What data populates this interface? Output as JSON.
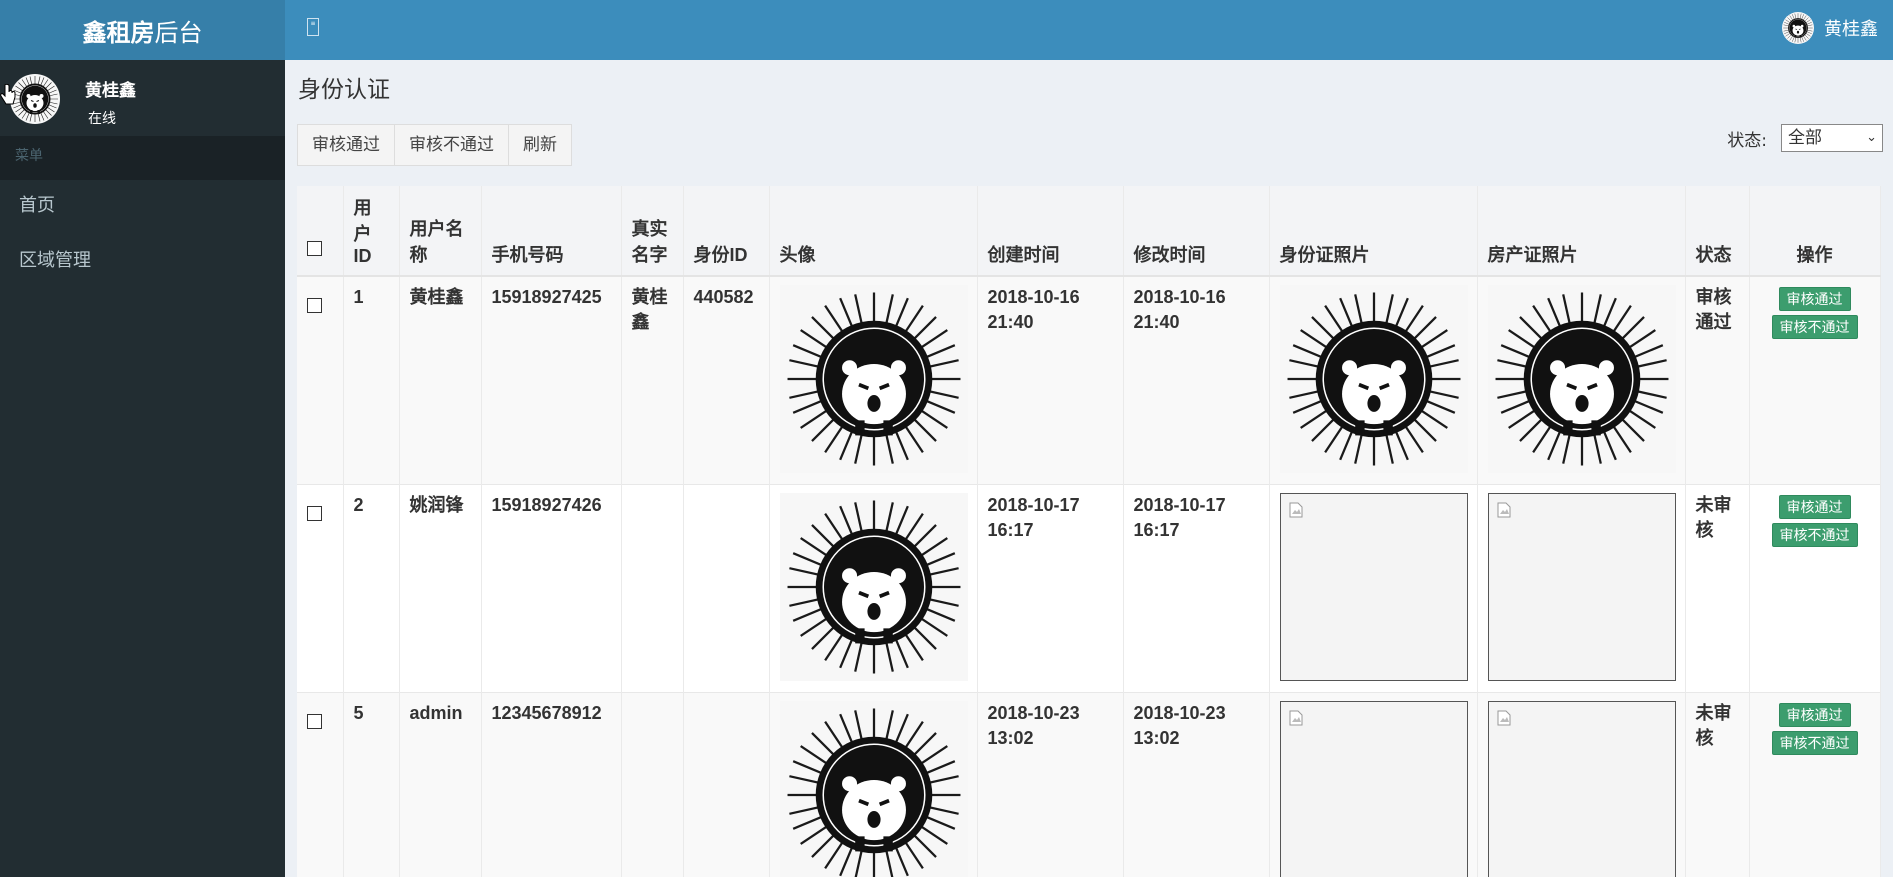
{
  "header": {
    "brand_bold": "鑫租房",
    "brand_light": "后台",
    "toggle_glyph": "≡",
    "user_name": "黄桂鑫"
  },
  "sidebar": {
    "user_name": "黄桂鑫",
    "user_status": "在线",
    "menu_header": "菜单",
    "items": [
      {
        "label": "首页"
      },
      {
        "label": "区域管理"
      }
    ]
  },
  "main": {
    "title": "身份认证",
    "actions": {
      "approve": "审核通过",
      "reject": "审核不通过",
      "refresh": "刷新"
    },
    "filter": {
      "label": "状态:",
      "selected": "全部"
    },
    "table": {
      "headers": {
        "id": "用户ID",
        "username": "用户名称",
        "phone": "手机号码",
        "realname": "真实名字",
        "idnum": "身份ID",
        "avatar": "头像",
        "created": "创建时间",
        "modified": "修改时间",
        "idphoto": "身份证照片",
        "deedphoto": "房产证照片",
        "status": "状态",
        "ops": "操作"
      },
      "rows": [
        {
          "id": "1",
          "username": "黄桂鑫",
          "phone": "15918927425",
          "realname": "黄桂鑫",
          "idnum": "440582",
          "created": "2018-10-16 21:40",
          "modified": "2018-10-16 21:40",
          "status": "审核通过",
          "approve": "审核通过",
          "reject": "审核不通过"
        },
        {
          "id": "2",
          "username": "姚润锋",
          "phone": "15918927426",
          "realname": "",
          "idnum": "",
          "created": "2018-10-17 16:17",
          "modified": "2018-10-17 16:17",
          "status": "未审核",
          "approve": "审核通过",
          "reject": "审核不通过"
        },
        {
          "id": "5",
          "username": "admin",
          "phone": "12345678912",
          "realname": "",
          "idnum": "",
          "created": "2018-10-23 13:02",
          "modified": "2018-10-23 13:02",
          "status": "未审核",
          "approve": "审核通过",
          "reject": "审核不通过"
        }
      ]
    }
  },
  "icons": {
    "avatar": "hedgehog-avatar-icon",
    "broken_image": "broken-image-icon",
    "menu_toggle": "menu-toggle-icon"
  },
  "colors": {
    "header": "#3c8dbc",
    "logo": "#367fa9",
    "sidebar": "#222d32",
    "success": "#3c9d6e"
  }
}
